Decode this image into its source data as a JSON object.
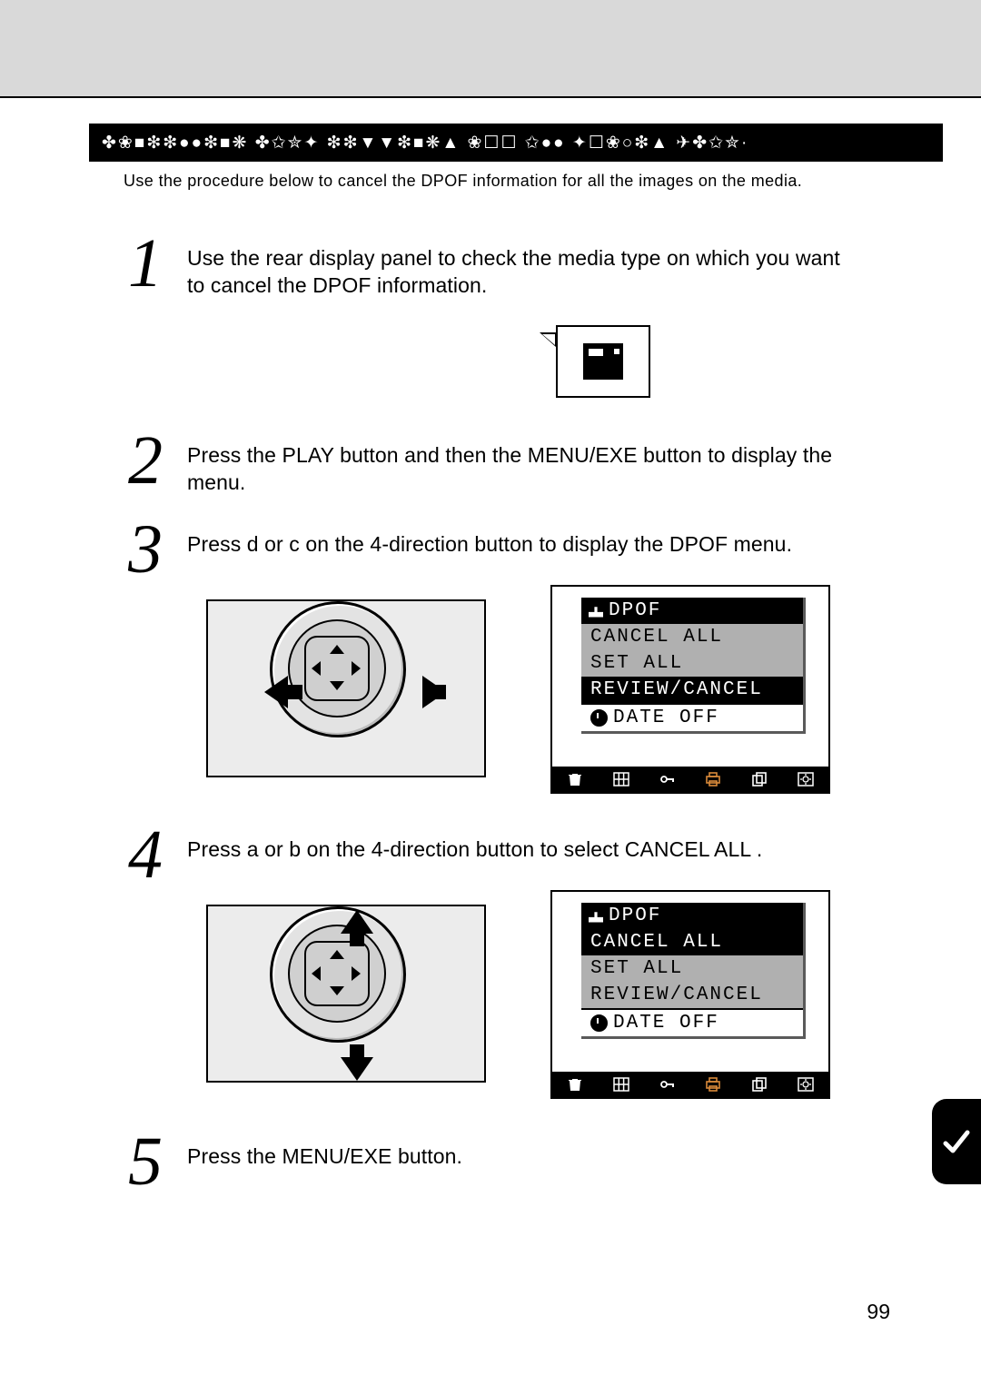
{
  "header_glyphs": "✤❀■❇❇●●❇■❋ ✤✩✮✦ ❇❇▼▼❇■❋▲ ❀☐☐ ✩●●  ✦☐❀○❇▲ ✈✤✩✮·",
  "intro": "Use the procedure below to cancel the DPOF information for all the images on the media.",
  "steps": {
    "s1": "Use the rear display panel to check the media type on which you want to cancel the DPOF information.",
    "s2": "Press the  PLAY  button and then the  MENU/EXE  button to display the menu.",
    "s3": "Press   d   or   c   on the 4-direction button to display the  DPOF  menu.",
    "s4": "Press   a   or   b   on the 4-direction button to select  CANCEL ALL .",
    "s5": "Press the  MENU/EXE  button."
  },
  "nums": {
    "n1": "1",
    "n2": "2",
    "n3": "3",
    "n4": "4",
    "n5": "5"
  },
  "lcd": {
    "title": "DPOF",
    "items": [
      "CANCEL ALL",
      "SET ALL",
      "REVIEW/CANCEL"
    ],
    "selected1": 2,
    "selected2": 0,
    "date": "DATE OFF"
  },
  "page_number": "99"
}
